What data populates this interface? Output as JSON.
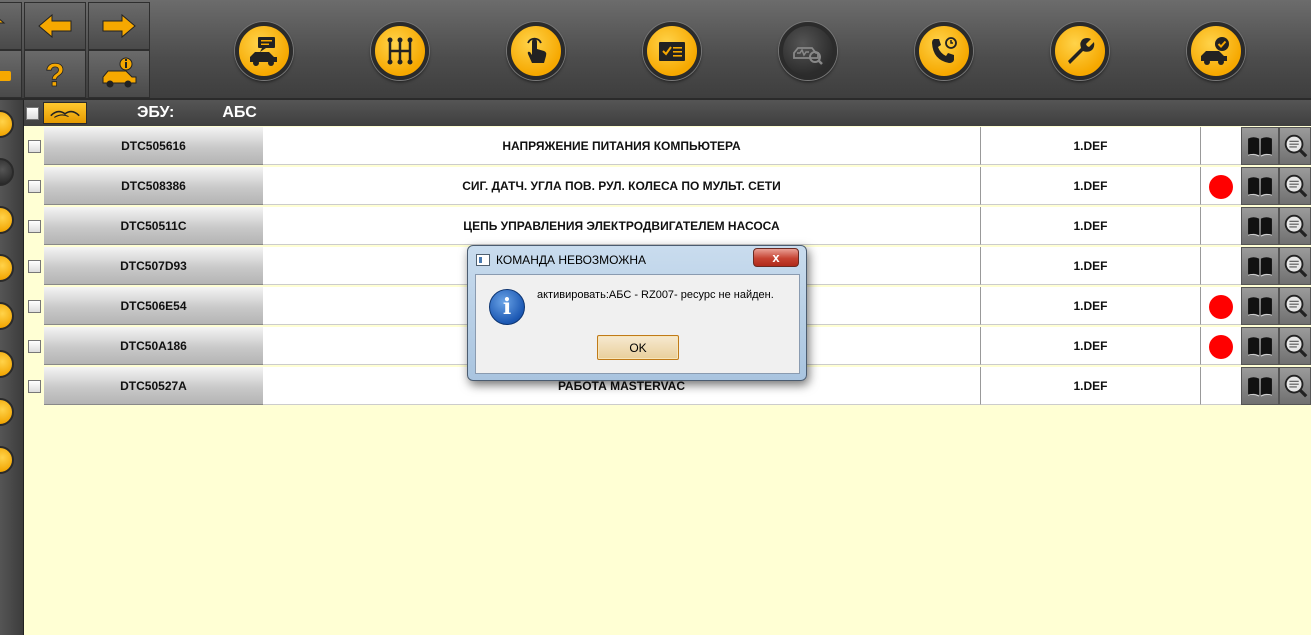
{
  "toolbar": {
    "nav_buttons": [
      "arrow-up-icon",
      "back-arrow-icon",
      "forward-arrow-icon",
      "vehicle-icon",
      "help-question-icon",
      "vehicle-info-icon"
    ],
    "round_buttons": [
      "vehicle-message-icon",
      "gear-shift-icon",
      "touch-hand-icon",
      "checklist-icon",
      "vehicle-diagnostic-icon",
      "phone-support-icon",
      "wrench-icon",
      "vehicle-check-icon"
    ],
    "active_round_button": "vehicle-diagnostic-icon",
    "accent_color": "#f6a800"
  },
  "ecu": {
    "label": "ЭБУ:",
    "value": "АБС"
  },
  "rows": [
    {
      "code": "DTC505616",
      "description": "НАПРЯЖЕНИЕ ПИТАНИЯ КОМПЬЮТЕРА",
      "status": "1.DEF",
      "flag": false
    },
    {
      "code": "DTC508386",
      "description": "СИГ. ДАТЧ. УГЛА ПОВ. РУЛ. КОЛЕСА ПО МУЛЬТ. СЕТИ",
      "status": "1.DEF",
      "flag": true
    },
    {
      "code": "DTC50511C",
      "description": "ЦЕПЬ УПРАВЛЕНИЯ ЭЛЕКТРОДВИГАТЕЛЕМ НАСОСА",
      "status": "1.DEF",
      "flag": false
    },
    {
      "code": "DTC507D93",
      "description": "",
      "status": "1.DEF",
      "flag": false
    },
    {
      "code": "DTC506E54",
      "description": "",
      "status": "1.DEF",
      "flag": true
    },
    {
      "code": "DTC50A186",
      "description": "",
      "status": "1.DEF",
      "flag": true
    },
    {
      "code": "DTC50527A",
      "description": "РАБОТА MASTERVAC",
      "status": "1.DEF",
      "flag": false
    }
  ],
  "dialog": {
    "title": "КОМАНДА НЕВОЗМОЖНА",
    "close_label": "x",
    "message": "активировать:АБС - RZ007- ресурс не найден.",
    "ok_label": "OK"
  },
  "colors": {
    "content_bg": "#ffffd4",
    "flag_red": "#ff0000",
    "ok_border": "#c07a18"
  }
}
